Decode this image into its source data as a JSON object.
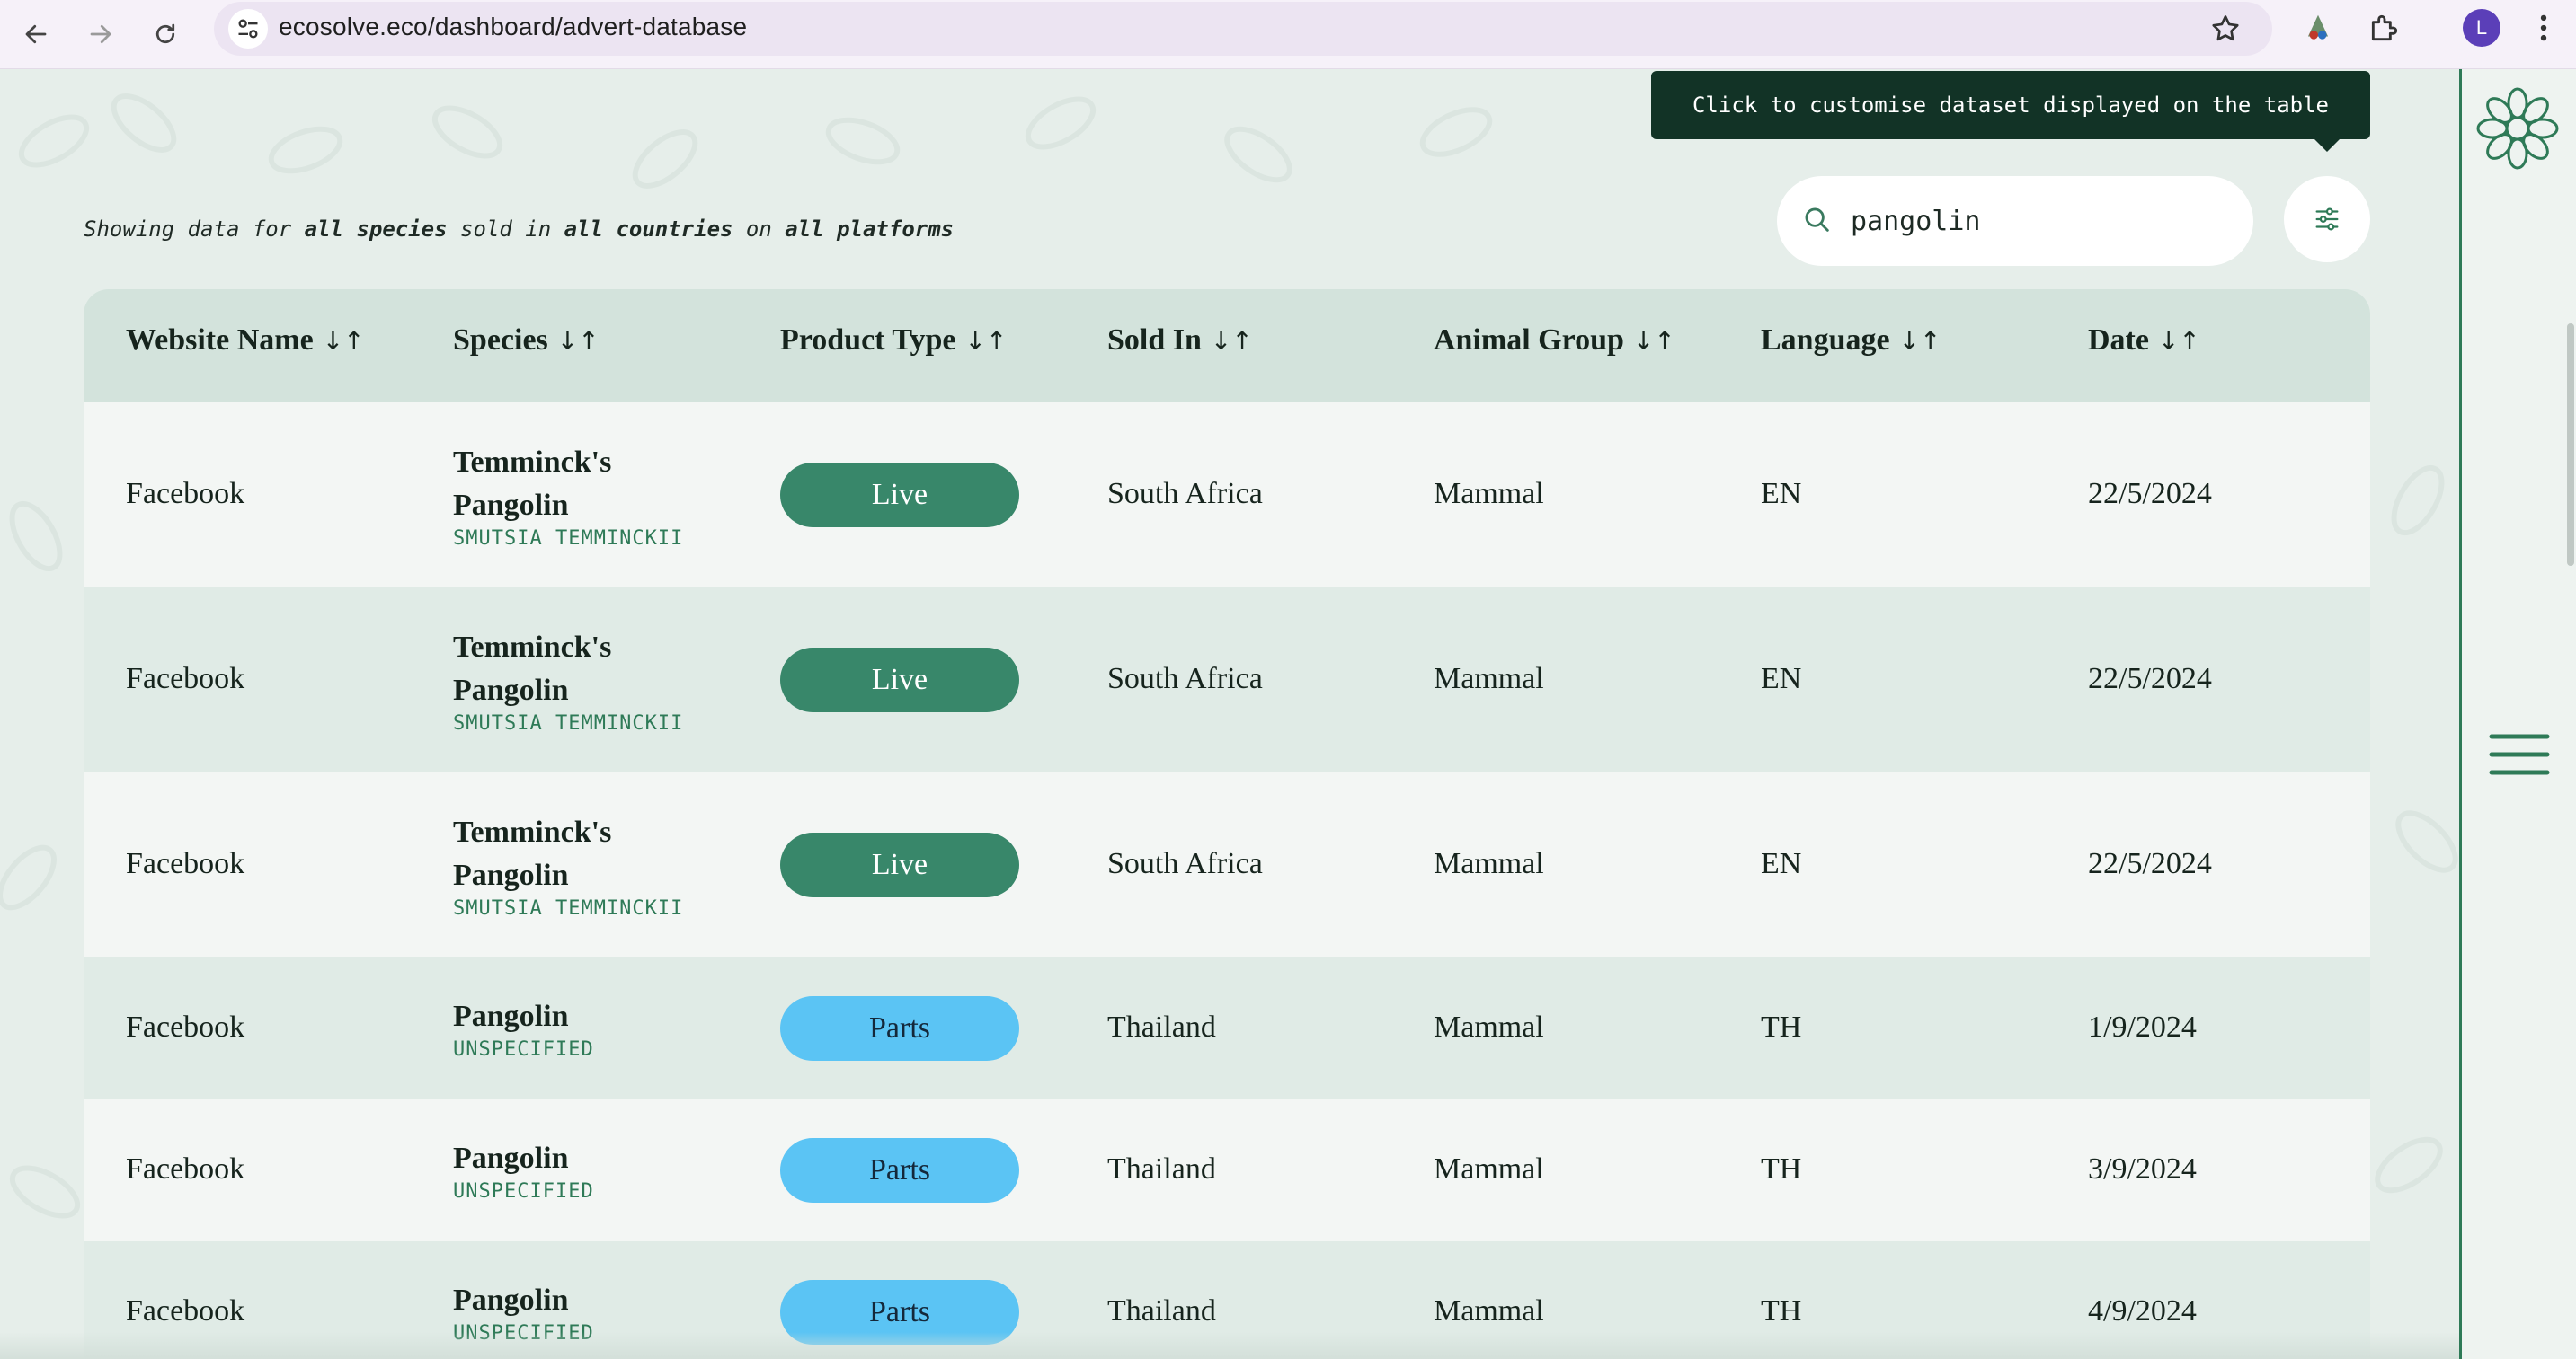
{
  "browser": {
    "url": "ecosolve.eco/dashboard/advert-database",
    "avatar_letter": "L"
  },
  "tooltip": "Click to customise dataset displayed on the table",
  "summary": {
    "prefix": "Showing data for ",
    "species": "all species",
    "mid1": " sold in ",
    "countries": "all countries",
    "mid2": " on ",
    "platforms": "all platforms"
  },
  "search": {
    "value": "pangolin"
  },
  "table": {
    "headers": [
      "Website Name",
      "Species",
      "Product Type",
      "Sold In",
      "Animal Group",
      "Language",
      "Date"
    ],
    "sort_glyph": "↓↑",
    "rows": [
      {
        "website": "Facebook",
        "species_line1": "Temminck's",
        "species_line2": "Pangolin",
        "scientific": "SMUTSIA TEMMINCKII",
        "product": "Live",
        "sold_in": "South Africa",
        "group": "Mammal",
        "language": "EN",
        "date": "22/5/2024"
      },
      {
        "website": "Facebook",
        "species_line1": "Temminck's",
        "species_line2": "Pangolin",
        "scientific": "SMUTSIA TEMMINCKII",
        "product": "Live",
        "sold_in": "South Africa",
        "group": "Mammal",
        "language": "EN",
        "date": "22/5/2024"
      },
      {
        "website": "Facebook",
        "species_line1": "Temminck's",
        "species_line2": "Pangolin",
        "scientific": "SMUTSIA TEMMINCKII",
        "product": "Live",
        "sold_in": "South Africa",
        "group": "Mammal",
        "language": "EN",
        "date": "22/5/2024"
      },
      {
        "website": "Facebook",
        "species_line1": "Pangolin",
        "species_line2": "",
        "scientific": "UNSPECIFIED",
        "product": "Parts",
        "sold_in": "Thailand",
        "group": "Mammal",
        "language": "TH",
        "date": "1/9/2024"
      },
      {
        "website": "Facebook",
        "species_line1": "Pangolin",
        "species_line2": "",
        "scientific": "UNSPECIFIED",
        "product": "Parts",
        "sold_in": "Thailand",
        "group": "Mammal",
        "language": "TH",
        "date": "3/9/2024"
      },
      {
        "website": "Facebook",
        "species_line1": "Pangolin",
        "species_line2": "",
        "scientific": "UNSPECIFIED",
        "product": "Parts",
        "sold_in": "Thailand",
        "group": "Mammal",
        "language": "TH",
        "date": "4/9/2024"
      }
    ]
  },
  "colors": {
    "accent": "#2e7a57",
    "live_badge": "#38876a",
    "parts_badge": "#5bc4f4",
    "tooltip_bg": "#123326"
  },
  "icons": [
    "back-arrow-icon",
    "forward-arrow-icon",
    "reload-icon",
    "site-settings-icon",
    "star-icon",
    "extension-icon",
    "puzzle-icon",
    "kebab-menu-icon",
    "search-icon",
    "filter-sliders-icon",
    "logo-icon",
    "hamburger-menu-icon"
  ]
}
